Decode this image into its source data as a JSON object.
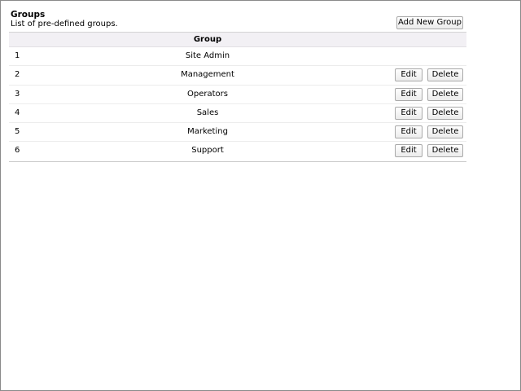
{
  "header": {
    "title": "Groups",
    "subtitle": "List of pre-defined groups.",
    "add_button_label": "Add New Group"
  },
  "table": {
    "column_header": "Group",
    "edit_label": "Edit",
    "delete_label": "Delete",
    "rows": [
      {
        "num": "1",
        "name": "Site Admin",
        "actions": false
      },
      {
        "num": "2",
        "name": "Management",
        "actions": true
      },
      {
        "num": "3",
        "name": "Operators",
        "actions": true
      },
      {
        "num": "4",
        "name": "Sales",
        "actions": true
      },
      {
        "num": "5",
        "name": "Marketing",
        "actions": true
      },
      {
        "num": "6",
        "name": "Support",
        "actions": true
      }
    ]
  }
}
